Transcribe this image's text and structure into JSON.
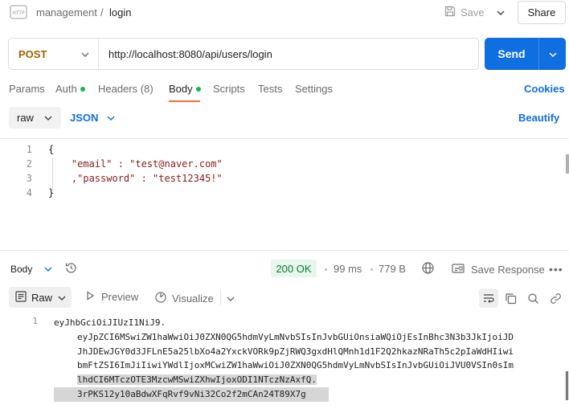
{
  "header": {
    "http_icon_text": "HTTP",
    "breadcrumb_parent": "management",
    "breadcrumb_sep": "/",
    "breadcrumb_current": "login",
    "save_label": "Save",
    "share_label": "Share"
  },
  "request": {
    "method": "POST",
    "url": "http://localhost:8080/api/users/login",
    "send_label": "Send"
  },
  "tabs": [
    {
      "label": "Params"
    },
    {
      "label": "Auth",
      "dot": true
    },
    {
      "label": "Headers",
      "count": "(8)"
    },
    {
      "label": "Body",
      "dot": true,
      "active": true
    },
    {
      "label": "Scripts"
    },
    {
      "label": "Tests"
    },
    {
      "label": "Settings"
    }
  ],
  "cookies_label": "Cookies",
  "body_options": {
    "mode": "raw",
    "language": "JSON",
    "beautify_label": "Beautify"
  },
  "editor": {
    "lines": [
      {
        "num": "1",
        "text": "{"
      },
      {
        "num": "2",
        "text": "    \"email\" : \"test@naver.com\""
      },
      {
        "num": "3",
        "text": "    ,\"password\" : \"test12345!\""
      },
      {
        "num": "4",
        "text": "}"
      }
    ]
  },
  "response": {
    "section_label": "Body",
    "status": "200 OK",
    "time": "99 ms",
    "size": "779 B",
    "save_response_label": "Save Response",
    "view_mode": "Raw",
    "preview_label": "Preview",
    "visualize_label": "Visualize",
    "line_num": "1",
    "body_lines": [
      "eyJhbGciOiJIUzI1NiJ9.",
      "eyJpZCI6MSwiZW1haWwiOiJ0ZXN0QG5hdmVyLmNvbSIsInJvbGUiOnsiaWQiOjEsInBhc3N3b3JkIjoiJD",
      "JhJDEwJGY0d3JFLnE5a25lbXo4a2YxckVORk9pZjRWQ3gxdHlQMnh1d1F2Q2hkazNRaTh5c2pIaWdHIiwi",
      "bmFtZSI6ImJiIiwiYWdlIjoxMCwiZW1haWwiOiJ0ZXN0QG5hdmVyLmNvbSIsInJvbGUiOiJVU0VSIn0sIm",
      "lhdCI6MTczOTE3MzcwMSwiZXhwIjoxODI1NTczNzAxfQ.",
      "3rPKS12y10aBdwXFqRvf9vNi32Co2f2mCAn24T89X7g"
    ]
  }
}
